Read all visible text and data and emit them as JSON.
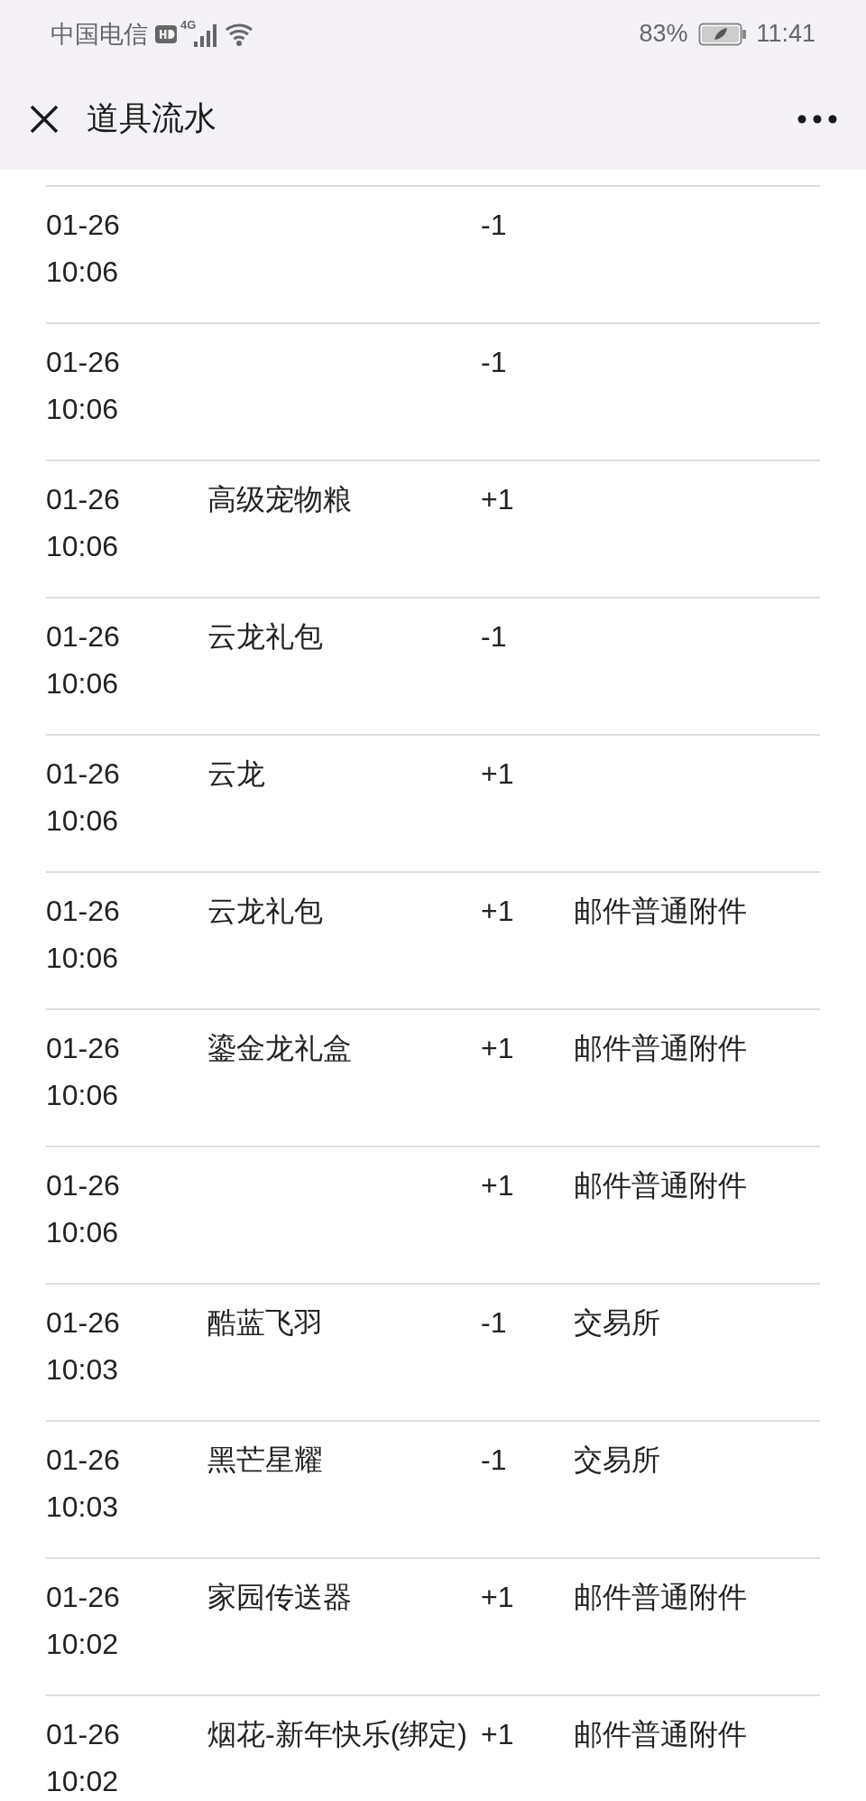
{
  "status_bar": {
    "carrier": "中国电信",
    "network": "4G",
    "battery": "83%",
    "time": "11:41"
  },
  "header": {
    "title": "道具流水"
  },
  "rows": [
    {
      "date": "01-26",
      "time": "10:06",
      "change": "-1"
    },
    {
      "date": "01-26",
      "time": "10:06",
      "change": "-1"
    },
    {
      "date": "01-26",
      "time": "10:06",
      "item": "高级宠物粮",
      "change": "+1"
    },
    {
      "date": "01-26",
      "time": "10:06",
      "item": "云龙礼包",
      "change": "-1"
    },
    {
      "date": "01-26",
      "time": "10:06",
      "item": "云龙",
      "change": "+1"
    },
    {
      "date": "01-26",
      "time": "10:06",
      "item": "云龙礼包",
      "change": "+1",
      "source": "邮件普通附件"
    },
    {
      "date": "01-26",
      "time": "10:06",
      "item": "鎏金龙礼盒",
      "change": "+1",
      "source": "邮件普通附件"
    },
    {
      "date": "01-26",
      "time": "10:06",
      "change": "+1",
      "source": "邮件普通附件"
    },
    {
      "date": "01-26",
      "time": "10:03",
      "item": "酷蓝飞羽",
      "change": "-1",
      "source": "交易所"
    },
    {
      "date": "01-26",
      "time": "10:03",
      "item": "黑芒星耀",
      "change": "-1",
      "source": "交易所"
    },
    {
      "date": "01-26",
      "time": "10:02",
      "item": "家园传送器",
      "change": "+1",
      "source": "邮件普通附件"
    },
    {
      "date": "01-26",
      "time": "10:02",
      "item": "烟花-新年快乐(绑定)",
      "change": "+1",
      "source": "邮件普通附件"
    }
  ]
}
